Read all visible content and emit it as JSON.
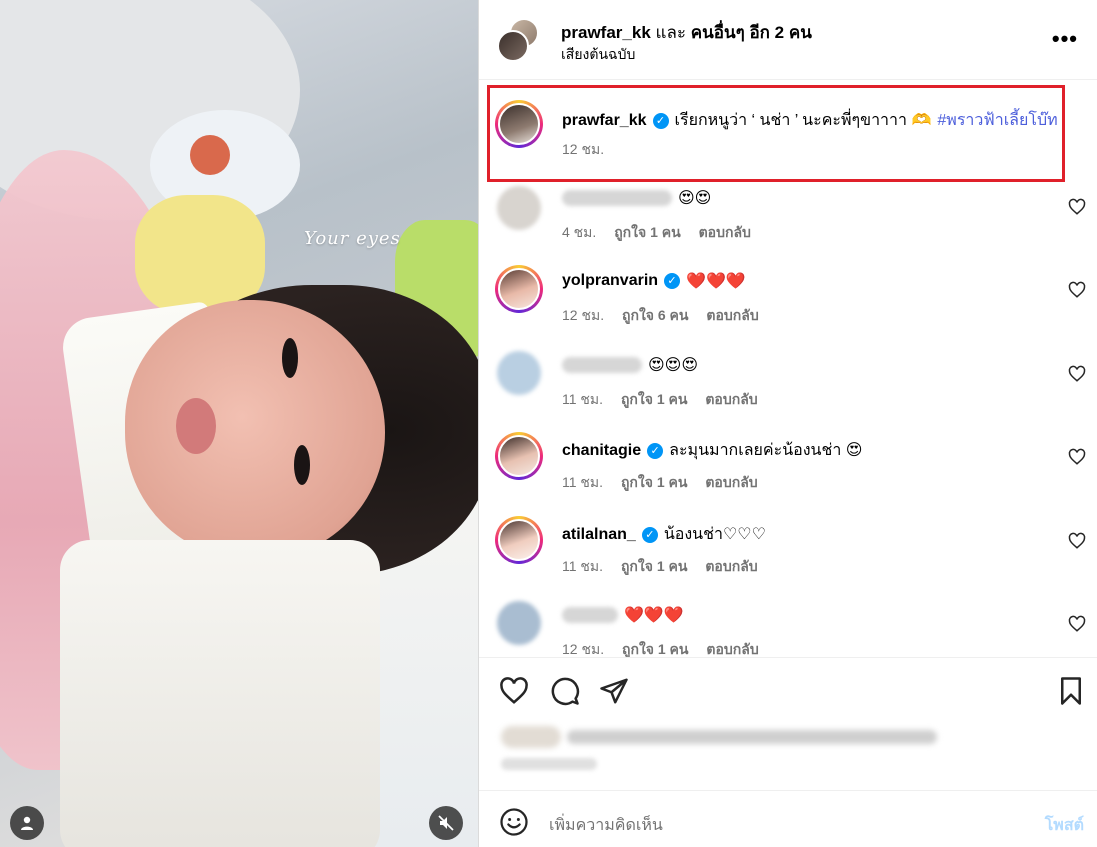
{
  "media": {
    "overlay_text": "Your eyes",
    "user_icon": "user-icon",
    "mute_icon": "speaker-muted-icon"
  },
  "header": {
    "username": "prawfar_kk",
    "joiner": "และ",
    "others": "คนอื่นๆ อีก 2 คน",
    "subtitle": "เสียงต้นฉบับ",
    "more": "•••"
  },
  "caption": {
    "username": "prawfar_kk",
    "text": "เรียกหนูว่า ‘ นช่า ’ นะคะพี่ๆขาาาา 🫶",
    "hashtag": "#พราวฟ้าเลี้ยโบ๊ท",
    "time": "12 ชม."
  },
  "comments": [
    {
      "username": "",
      "blurred": true,
      "text": "😍😍",
      "time": "4 ชม.",
      "likes": "ถูกใจ 1 คน",
      "reply": "ตอบกลับ"
    },
    {
      "username": "yolpranvarin",
      "verified": true,
      "text": "❤️❤️❤️",
      "time": "12 ชม.",
      "likes": "ถูกใจ 6 คน",
      "reply": "ตอบกลับ"
    },
    {
      "username": "",
      "blurred": true,
      "text": "😍😍😍",
      "time": "11 ชม.",
      "likes": "ถูกใจ 1 คน",
      "reply": "ตอบกลับ"
    },
    {
      "username": "chanitagie",
      "verified": true,
      "text": "ละมุนมากเลยค่ะน้องนช่า 😍",
      "time": "11 ชม.",
      "likes": "ถูกใจ 1 คน",
      "reply": "ตอบกลับ"
    },
    {
      "username": "atilalnan_",
      "verified": true,
      "text": "น้องนช่า♡♡♡",
      "time": "11 ชม.",
      "likes": "ถูกใจ 1 คน",
      "reply": "ตอบกลับ"
    },
    {
      "username": "",
      "blurred": true,
      "text": "❤️❤️❤️",
      "time": "12 ชม.",
      "likes": "ถูกใจ 1 คน",
      "reply": "ตอบกลับ"
    }
  ],
  "add_comment": {
    "placeholder": "เพิ่มความคิดเห็น",
    "post": "โพสต์"
  },
  "colors": {
    "highlight_box": "#e0202a",
    "verified": "#0095f6",
    "hashtag": "#4c5edb",
    "post_disabled": "#b3dbff"
  }
}
